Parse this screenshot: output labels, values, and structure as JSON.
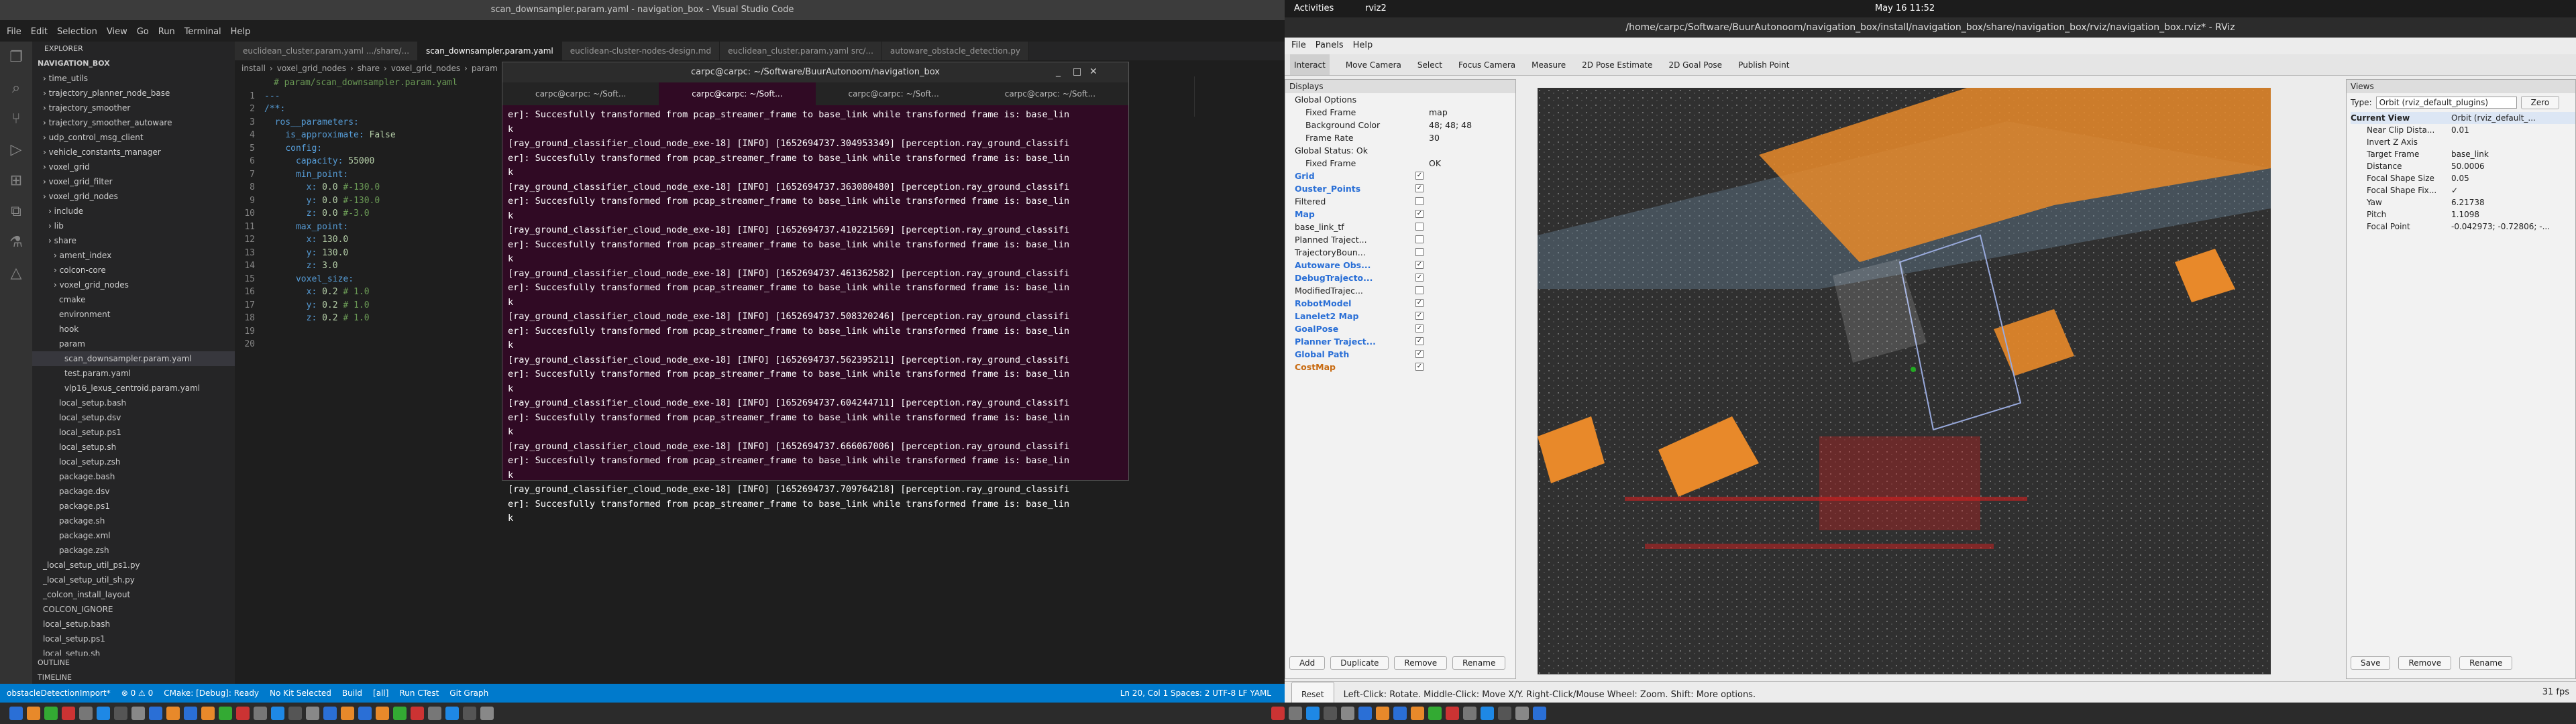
{
  "vscode": {
    "title": "scan_downsampler.param.yaml - navigation_box - Visual Studio Code",
    "menu": [
      "File",
      "Edit",
      "Selection",
      "View",
      "Go",
      "Run",
      "Terminal",
      "Help"
    ],
    "explorer_title": "EXPLORER",
    "root": "NAVIGATION_BOX",
    "tree": [
      "time_utils",
      "trajectory_planner_node_base",
      "trajectory_smoother",
      "trajectory_smoother_autoware",
      "udp_control_msg_client",
      "vehicle_constants_manager",
      "voxel_grid",
      "voxel_grid_filter",
      "voxel_grid_nodes",
      "include",
      "lib",
      "share",
      "ament_index",
      "colcon-core",
      "voxel_grid_nodes",
      "cmake",
      "environment",
      "hook",
      "param",
      "scan_downsampler.param.yaml",
      "test.param.yaml",
      "vlp16_lexus_centroid.param.yaml",
      "local_setup.bash",
      "local_setup.dsv",
      "local_setup.ps1",
      "local_setup.sh",
      "local_setup.zsh",
      "package.bash",
      "package.dsv",
      "package.ps1",
      "package.sh",
      "package.xml",
      "package.zsh",
      "_local_setup_util_ps1.py",
      "_local_setup_util_sh.py",
      "_colcon_install_layout",
      "COLCON_IGNORE",
      "local_setup.bash",
      "local_setup.ps1",
      "local_setup.sh"
    ],
    "outline": "OUTLINE",
    "timeline": "TIMELINE",
    "tabs": [
      "euclidean_cluster.param.yaml .../share/...",
      "scan_downsampler.param.yaml",
      "euclidean-cluster-nodes-design.md",
      "euclidean_cluster.param.yaml src/...",
      "autoware_obstacle_detection.py"
    ],
    "breadcrumb": [
      "install",
      "voxel_grid_nodes",
      "share",
      "voxel_grid_nodes",
      "param"
    ],
    "code": [
      [
        "1",
        "---"
      ],
      [
        "2",
        "/**:"
      ],
      [
        "3",
        "  ros__parameters:"
      ],
      [
        "4",
        "    is_approximate: False"
      ],
      [
        "5",
        "    config:"
      ],
      [
        "6",
        "      capacity: 55000"
      ],
      [
        "7",
        "      min_point:"
      ],
      [
        "8",
        "        x: 0.0 #-130.0"
      ],
      [
        "9",
        "        y: 0.0 #-130.0"
      ],
      [
        "10",
        "        z: 0.0 #-3.0"
      ],
      [
        "11",
        "      max_point:"
      ],
      [
        "12",
        "        x: 130.0"
      ],
      [
        "13",
        "        y: 130.0"
      ],
      [
        "14",
        "        z: 3.0"
      ],
      [
        "15",
        "      voxel_size:"
      ],
      [
        "16",
        "        x: 0.2 # 1.0"
      ],
      [
        "17",
        "        y: 0.2 # 1.0"
      ],
      [
        "18",
        "        z: 0.2 # 1.0"
      ],
      [
        "19",
        ""
      ],
      [
        "20",
        ""
      ]
    ],
    "code_comment": "# param/scan_downsampler.param.yaml",
    "status": [
      "obstacleDetectionImport*",
      "⊗ 0 ⚠ 0",
      "CMake: [Debug]: Ready",
      "No Kit Selected",
      "Build",
      "[all]",
      "Run CTest",
      "Git Graph"
    ],
    "status_right": "Ln 20, Col 1   Spaces: 2   UTF-8   LF   YAML"
  },
  "terminal": {
    "title": "carpc@carpc: ~/Software/BuurAutonoom/navigation_box",
    "tabs": [
      "carpc@carpc: ~/Soft...",
      "carpc@carpc: ~/Soft...",
      "carpc@carpc: ~/Soft...",
      "carpc@carpc: ~/Soft..."
    ],
    "lines": [
      "er]: Succesfully transformed from pcap_streamer_frame to base_link while transformed frame is: base_lin",
      "k",
      "[ray_ground_classifier_cloud_node_exe-18] [INFO] [1652694737.304953349] [perception.ray_ground_classifi",
      "er]: Succesfully transformed from pcap_streamer_frame to base_link while transformed frame is: base_lin",
      "k",
      "[ray_ground_classifier_cloud_node_exe-18] [INFO] [1652694737.363080480] [perception.ray_ground_classifi",
      "er]: Succesfully transformed from pcap_streamer_frame to base_link while transformed frame is: base_lin",
      "k",
      "[ray_ground_classifier_cloud_node_exe-18] [INFO] [1652694737.410221569] [perception.ray_ground_classifi",
      "er]: Succesfully transformed from pcap_streamer_frame to base_link while transformed frame is: base_lin",
      "k",
      "[ray_ground_classifier_cloud_node_exe-18] [INFO] [1652694737.461362582] [perception.ray_ground_classifi",
      "er]: Succesfully transformed from pcap_streamer_frame to base_link while transformed frame is: base_lin",
      "k",
      "[ray_ground_classifier_cloud_node_exe-18] [INFO] [1652694737.508320246] [perception.ray_ground_classifi",
      "er]: Succesfully transformed from pcap_streamer_frame to base_link while transformed frame is: base_lin",
      "k",
      "[ray_ground_classifier_cloud_node_exe-18] [INFO] [1652694737.562395211] [perception.ray_ground_classifi",
      "er]: Succesfully transformed from pcap_streamer_frame to base_link while transformed frame is: base_lin",
      "k",
      "[ray_ground_classifier_cloud_node_exe-18] [INFO] [1652694737.604244711] [perception.ray_ground_classifi",
      "er]: Succesfully transformed from pcap_streamer_frame to base_link while transformed frame is: base_lin",
      "k",
      "[ray_ground_classifier_cloud_node_exe-18] [INFO] [1652694737.666067006] [perception.ray_ground_classifi",
      "er]: Succesfully transformed from pcap_streamer_frame to base_link while transformed frame is: base_lin",
      "k",
      "[ray_ground_classifier_cloud_node_exe-18] [INFO] [1652694737.709764218] [perception.ray_ground_classifi",
      "er]: Succesfully transformed from pcap_streamer_frame to base_link while transformed frame is: base_lin",
      "k"
    ]
  },
  "gnome": {
    "activities": "Activities",
    "app": "rviz2",
    "clock": "May 16  11:52"
  },
  "rviz": {
    "title": "/home/carpc/Software/BuurAutonoom/navigation_box/install/navigation_box/share/navigation_box/rviz/navigation_box.rviz* - RViz",
    "menu": [
      "File",
      "Panels",
      "Help"
    ],
    "tools": [
      "Interact",
      "Move Camera",
      "Select",
      "Focus Camera",
      "Measure",
      "2D Pose Estimate",
      "2D Goal Pose",
      "Publish Point"
    ],
    "displays_title": "Displays",
    "global": [
      [
        "Global Options",
        ""
      ],
      [
        "Fixed Frame",
        "map"
      ],
      [
        "Background Color",
        "48; 48; 48"
      ],
      [
        "Frame Rate",
        "30"
      ],
      [
        "Global Status: Ok",
        ""
      ],
      [
        "Fixed Frame",
        "OK"
      ]
    ],
    "displays": [
      [
        "Grid",
        true,
        "blue"
      ],
      [
        "Ouster_Points",
        true,
        "blue"
      ],
      [
        "Filtered",
        false,
        "black"
      ],
      [
        "Map",
        true,
        "blue"
      ],
      [
        "base_link_tf",
        false,
        "black"
      ],
      [
        "Planned Traject...",
        false,
        "black"
      ],
      [
        "TrajectoryBoun...",
        false,
        "black"
      ],
      [
        "Autoware Obs...",
        true,
        "blue"
      ],
      [
        "DebugTrajecto...",
        true,
        "blue"
      ],
      [
        "ModifiedTrajec...",
        false,
        "black"
      ],
      [
        "RobotModel",
        true,
        "blue"
      ],
      [
        "Lanelet2 Map",
        true,
        "blue"
      ],
      [
        "GoalPose",
        true,
        "blue"
      ],
      [
        "Planner Traject...",
        true,
        "blue"
      ],
      [
        "Global Path",
        true,
        "blue"
      ],
      [
        "CostMap",
        true,
        "orange"
      ]
    ],
    "display_buttons": [
      "Add",
      "Duplicate",
      "Remove",
      "Rename"
    ],
    "views_title": "Views",
    "views_type_label": "Type:",
    "views_type": "Orbit (rviz_default_plugins)",
    "views_zero": "Zero",
    "current_view": [
      "Current View",
      "Orbit (rviz_default_..."
    ],
    "view_props": [
      [
        "Near Clip Dista...",
        "0.01"
      ],
      [
        "Invert Z Axis",
        ""
      ],
      [
        "Target Frame",
        "base_link"
      ],
      [
        "Distance",
        "50.0006"
      ],
      [
        "Focal Shape Size",
        "0.05"
      ],
      [
        "Focal Shape Fix...",
        "✓"
      ],
      [
        "Yaw",
        "6.21738"
      ],
      [
        "Pitch",
        "1.1098"
      ],
      [
        "Focal Point",
        "-0.042973; -0.72806; -..."
      ]
    ],
    "views_buttons": [
      "Save",
      "Remove",
      "Rename"
    ],
    "status_reset": "Reset",
    "status_hint": "Left-Click: Rotate. Middle-Click: Move X/Y. Right-Click/Mouse Wheel: Zoom. Shift: More options.",
    "fps": "31 fps"
  },
  "colors": {
    "accent": "#007acc",
    "terminal_bg": "#300a24",
    "orange": "#e8892a"
  }
}
